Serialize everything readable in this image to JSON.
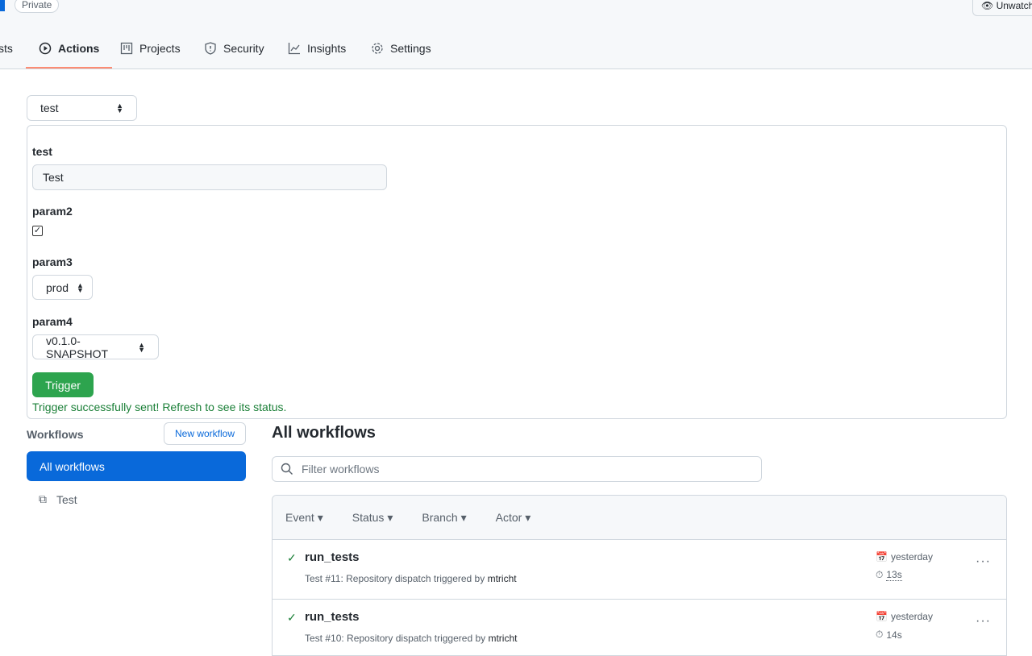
{
  "header": {
    "visibility": "Private",
    "watch_label": "Unwatch",
    "tabs": [
      {
        "label": "sts"
      },
      {
        "label": "Actions"
      },
      {
        "label": "Projects"
      },
      {
        "label": "Security"
      },
      {
        "label": "Insights"
      },
      {
        "label": "Settings"
      }
    ]
  },
  "dispatch": {
    "workflow_select": "test",
    "fields": [
      {
        "label": "test",
        "value": "Test"
      },
      {
        "label": "param2",
        "checked": true
      },
      {
        "label": "param3",
        "value": "prod"
      },
      {
        "label": "param4",
        "value": "v0.1.0-SNAPSHOT"
      }
    ],
    "trigger_label": "Trigger",
    "status": "Trigger successfully sent! Refresh to see its status."
  },
  "sidebar": {
    "title": "Workflows",
    "new_label": "New workflow",
    "items": [
      {
        "label": "All workflows"
      },
      {
        "label": "Test"
      }
    ]
  },
  "main": {
    "title": "All workflows",
    "filter_placeholder": "Filter workflows",
    "filters": [
      "Event",
      "Status",
      "Branch",
      "Actor"
    ],
    "runs": [
      {
        "name": "run_tests",
        "prefix": "Test #11: Repository dispatch triggered by ",
        "actor": "mtricht",
        "date": "yesterday",
        "duration": "13s"
      },
      {
        "name": "run_tests",
        "prefix": "Test #10: Repository dispatch triggered by ",
        "actor": "mtricht",
        "date": "yesterday",
        "duration": "14s"
      }
    ]
  }
}
